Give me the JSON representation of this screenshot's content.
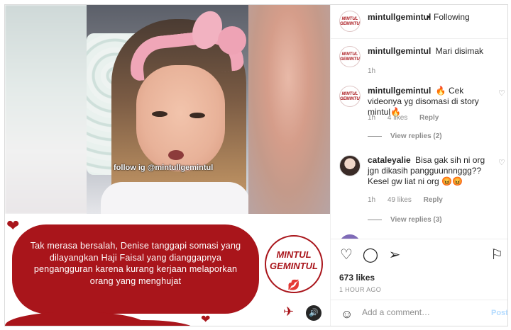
{
  "post": {
    "watermark": "follow ig @mintullgemintul",
    "caption_card": "Tak merasa bersalah, Denise tanggapi somasi yang dilayangkan Haji Faisal yang dianggapnya pengangguran karena kurang kerjaan melaporkan orang yang menghujat",
    "stamp_line1": "MINTUL",
    "stamp_line2": "GEMINTUL",
    "accent_color": "#a9151b"
  },
  "header": {
    "username": "mintullgemintul",
    "separator": "•",
    "follow_status": "Following",
    "avatar_text": "MINTUL GEMINTUL"
  },
  "comments": [
    {
      "username": "mintullgemintul",
      "text": "Mari disimak",
      "time": "1h"
    },
    {
      "username": "mintullgemintul",
      "text": "🔥 Cek videonya yg disomasi di story mintul🔥",
      "time": "1h",
      "likes": "4 likes",
      "reply": "Reply",
      "view_replies": "View replies (2)"
    },
    {
      "username": "cataleyalie",
      "text": "Bisa gak sih ni org jgn dikasih pangguunnnggg?? Kesel gw liat ni org 😡😡",
      "time": "1h",
      "likes": "49 likes",
      "reply": "Reply",
      "view_replies": "View replies (3)"
    }
  ],
  "actions": {
    "likes": "673 likes",
    "timestamp": "1 HOUR AGO"
  },
  "add_comment": {
    "placeholder": "Add a comment…",
    "post_label": "Post"
  },
  "icons": {
    "like": "heart-icon",
    "comment": "comment-icon",
    "share": "send-icon",
    "save": "bookmark-icon",
    "emoji": "emoji-icon",
    "sound": "speaker-icon"
  }
}
